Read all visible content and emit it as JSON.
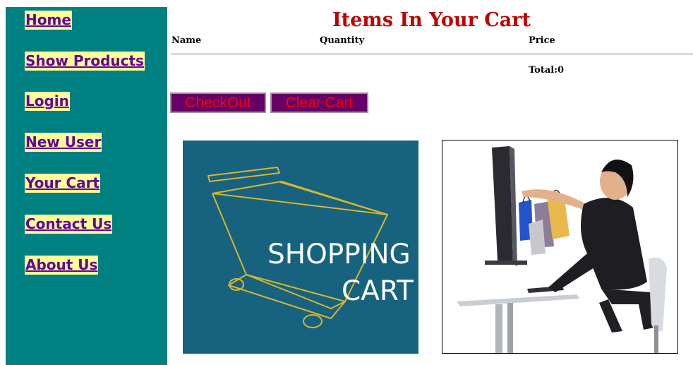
{
  "sidebar": {
    "items": [
      {
        "label": "Home"
      },
      {
        "label": "Show Products"
      },
      {
        "label": "Login"
      },
      {
        "label": "New User"
      },
      {
        "label": "Your Cart"
      },
      {
        "label": "Contact Us"
      },
      {
        "label": "About Us"
      }
    ]
  },
  "main": {
    "title": "Items In Your Cart",
    "columns": {
      "name": "Name",
      "quantity": "Quantity",
      "price": "Price"
    },
    "total_label": "Total:0",
    "buttons": {
      "checkout": "CheckOut",
      "clear_cart": "Clear Cart"
    }
  },
  "images": {
    "shopping_cart": {
      "line1": "SHOPPING",
      "line2": "CART"
    }
  },
  "colors": {
    "sidebar_bg": "#008080",
    "nav_bg": "#ffff99",
    "nav_text": "#660099",
    "title": "#c00000",
    "button_bg": "#660066",
    "button_text": "#ff0000",
    "cart_image_bg": "#17627f"
  }
}
